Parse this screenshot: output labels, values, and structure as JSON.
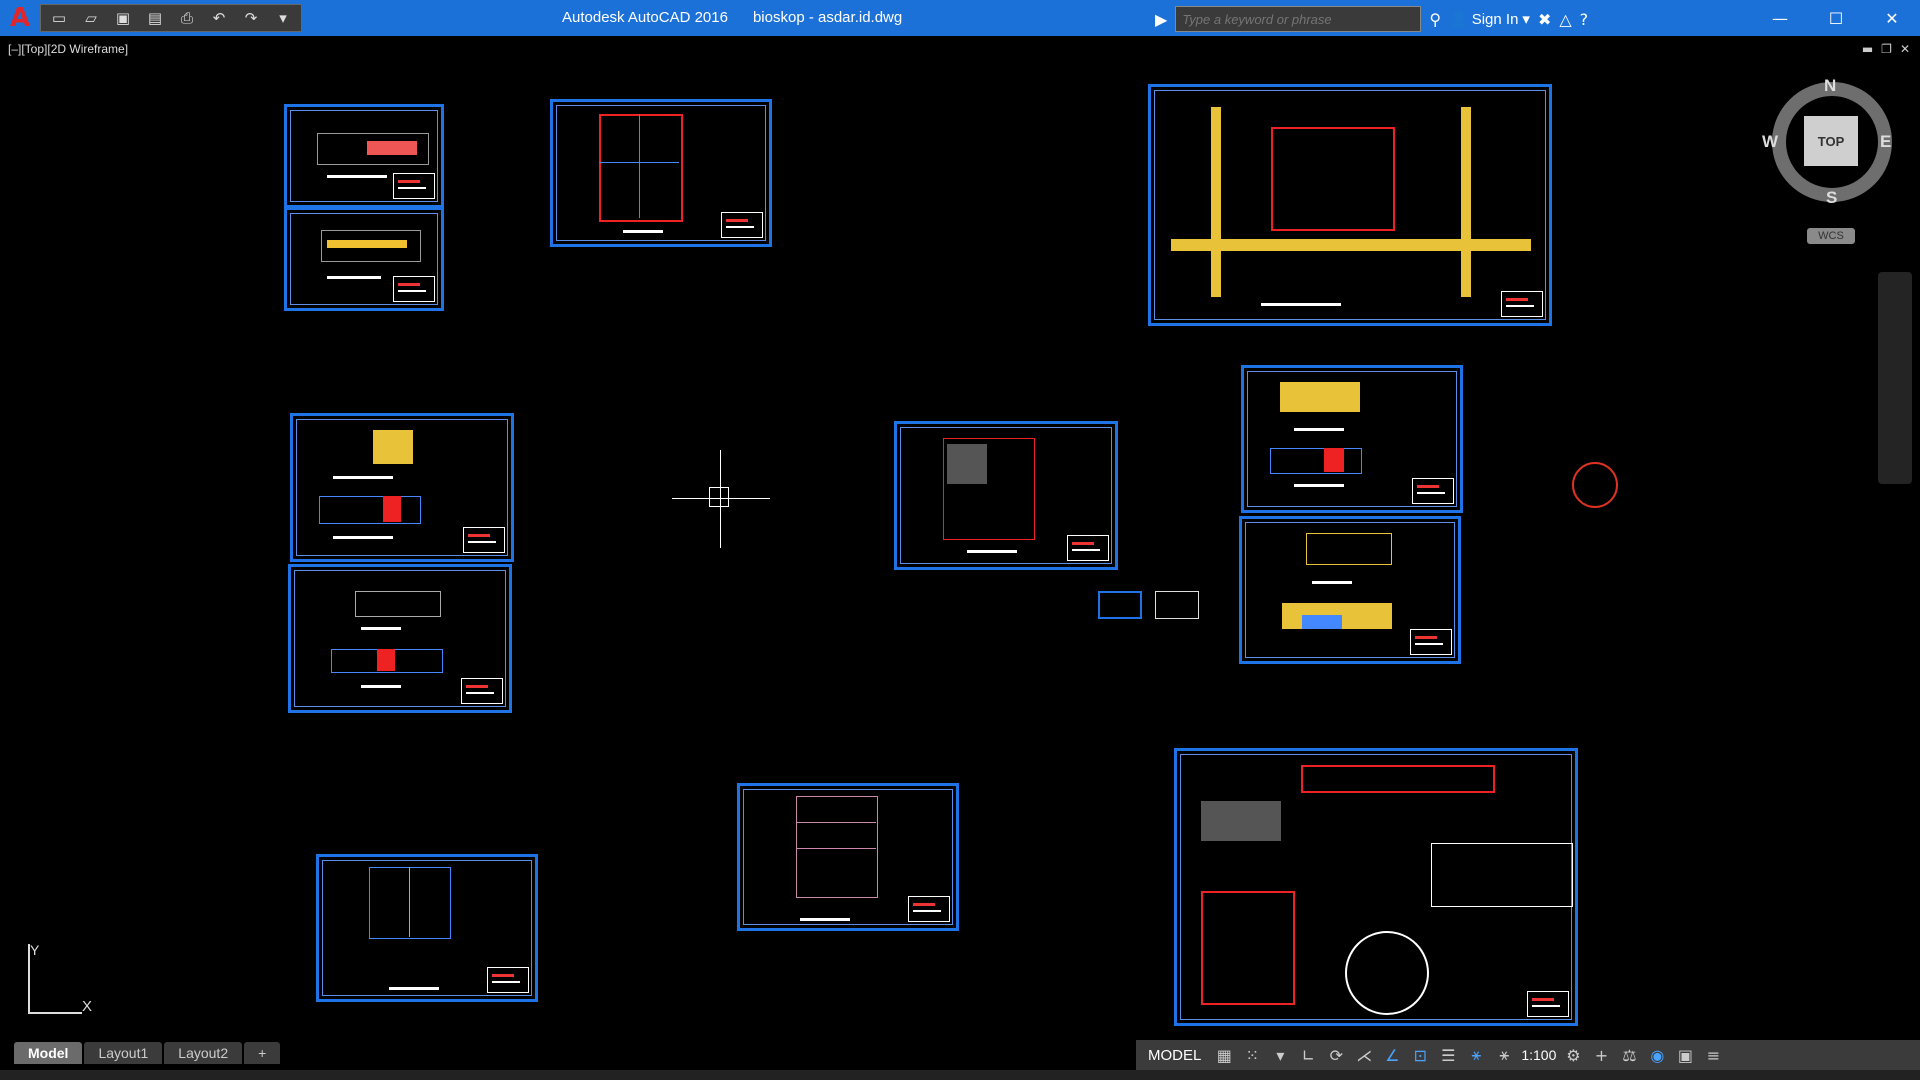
{
  "window": {
    "app_name": "Autodesk AutoCAD 2016",
    "file_name": "bioskop - asdar.id.dwg"
  },
  "title_bar": {
    "search_placeholder": "Type a keyword or phrase",
    "sign_in_label": "Sign In"
  },
  "viewport": {
    "label": "[–][Top][2D Wireframe]"
  },
  "viewcube": {
    "top_face": "TOP",
    "north": "N",
    "south": "S",
    "east": "E",
    "west": "W",
    "wcs_label": "WCS"
  },
  "ucs": {
    "x_label": "X",
    "y_label": "Y"
  },
  "layout_tabs": [
    {
      "label": "Model",
      "active": true
    },
    {
      "label": "Layout1",
      "active": false
    },
    {
      "label": "Layout2",
      "active": false
    },
    {
      "label": "+",
      "active": false
    }
  ],
  "statusbar": {
    "model_label": "MODEL",
    "scale_label": "1:100"
  },
  "colors": {
    "title_bar": "#1c71d8",
    "sheet_border": "#1e74e6",
    "drawing_bg": "#000000",
    "statusbar_bg": "#3b3b3b"
  },
  "icons": {
    "app": "autocad-logo-icon",
    "qat": [
      "new-icon",
      "open-icon",
      "save-icon",
      "save-as-icon",
      "print-icon",
      "undo-icon",
      "redo-icon",
      "dropdown-icon"
    ],
    "title_right": [
      "binoculars-icon",
      "user-icon",
      "exchange-icon",
      "autodesk-app-icon",
      "help-icon"
    ]
  }
}
